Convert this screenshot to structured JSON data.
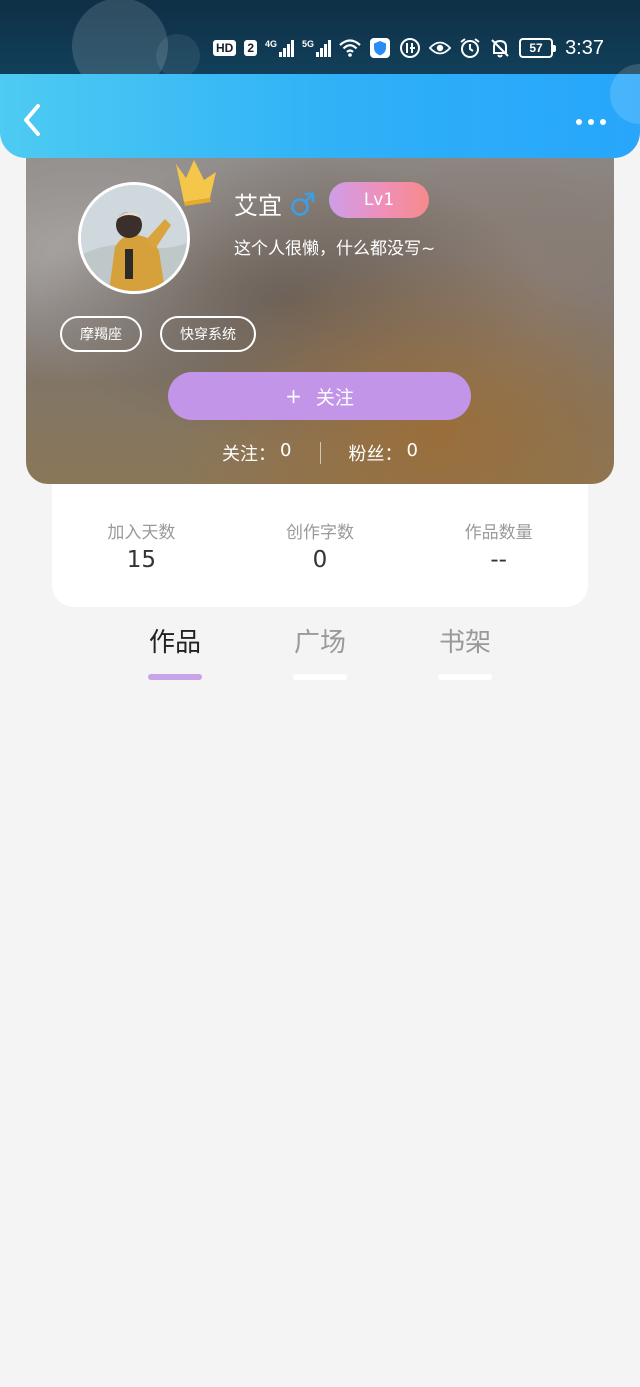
{
  "status_bar": {
    "hd": "HD",
    "sim": "2",
    "net1": "4G",
    "net2": "5G",
    "battery": "57",
    "time": "3:37"
  },
  "header": {
    "back_icon": "chevron-left-icon",
    "more_icon": "more-dots-icon"
  },
  "profile": {
    "name": "艾宜",
    "gender_symbol": "♂",
    "level": "Lv1",
    "bio": "这个人很懒，什么都没写~",
    "tags": [
      "摩羯座",
      "快穿系统"
    ],
    "follow_plus": "+",
    "follow_label": "关注",
    "following_label": "关注：",
    "following_count": "0",
    "fans_label": "粉丝：",
    "fans_count": "0"
  },
  "stats": [
    {
      "label": "加入天数",
      "value": "15"
    },
    {
      "label": "创作字数",
      "value": "0"
    },
    {
      "label": "作品数量",
      "value": "--"
    }
  ],
  "tabs": [
    {
      "label": "作品",
      "active": true
    },
    {
      "label": "广场",
      "active": false
    },
    {
      "label": "书架",
      "active": false
    }
  ],
  "colors": {
    "header_start": "#4dcbf2",
    "header_end": "#27a6fb",
    "follow_button": "#c295e8",
    "tab_active_underline": "#c8a3e8",
    "gender_blue": "#3aa0e6"
  }
}
